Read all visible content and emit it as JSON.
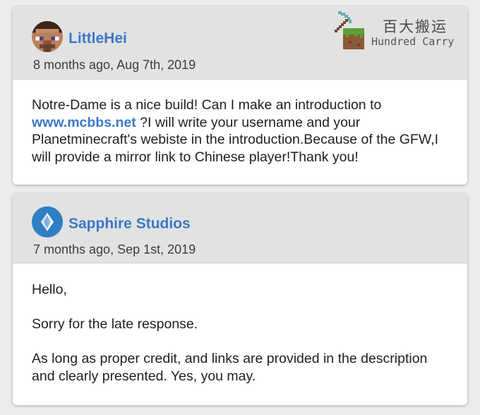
{
  "watermark": {
    "title_cn": "百大搬运",
    "title_en": "Hundred Carry",
    "icon": "pickaxe-grass-block-icon"
  },
  "comments": [
    {
      "author": "LittleHei",
      "avatar": "steve-avatar",
      "timestamp": "8 months ago, Aug 7th, 2019",
      "body_before_link": "Notre-Dame is a nice build! Can I make an introduction to ",
      "link_text": "www.mcbbs.net",
      "body_after_link": " ?I will write your username and your Planetminecraft's webiste in the introduction.Because of the GFW,I will provide a mirror link to Chinese player!Thank you!"
    },
    {
      "author": "Sapphire Studios",
      "avatar": "diamond-logo-avatar",
      "timestamp": "7 months ago, Sep 1st, 2019",
      "paragraphs": [
        "Hello,",
        "Sorry for the late response.",
        "As long as proper credit, and links are provided in the description and clearly presented. Yes, you may."
      ]
    }
  ],
  "colors": {
    "accent": "#3b78c8",
    "card_header": "#e2e2e2",
    "page_background": "#ececec",
    "sapphire_avatar": "#2f7fc4"
  }
}
